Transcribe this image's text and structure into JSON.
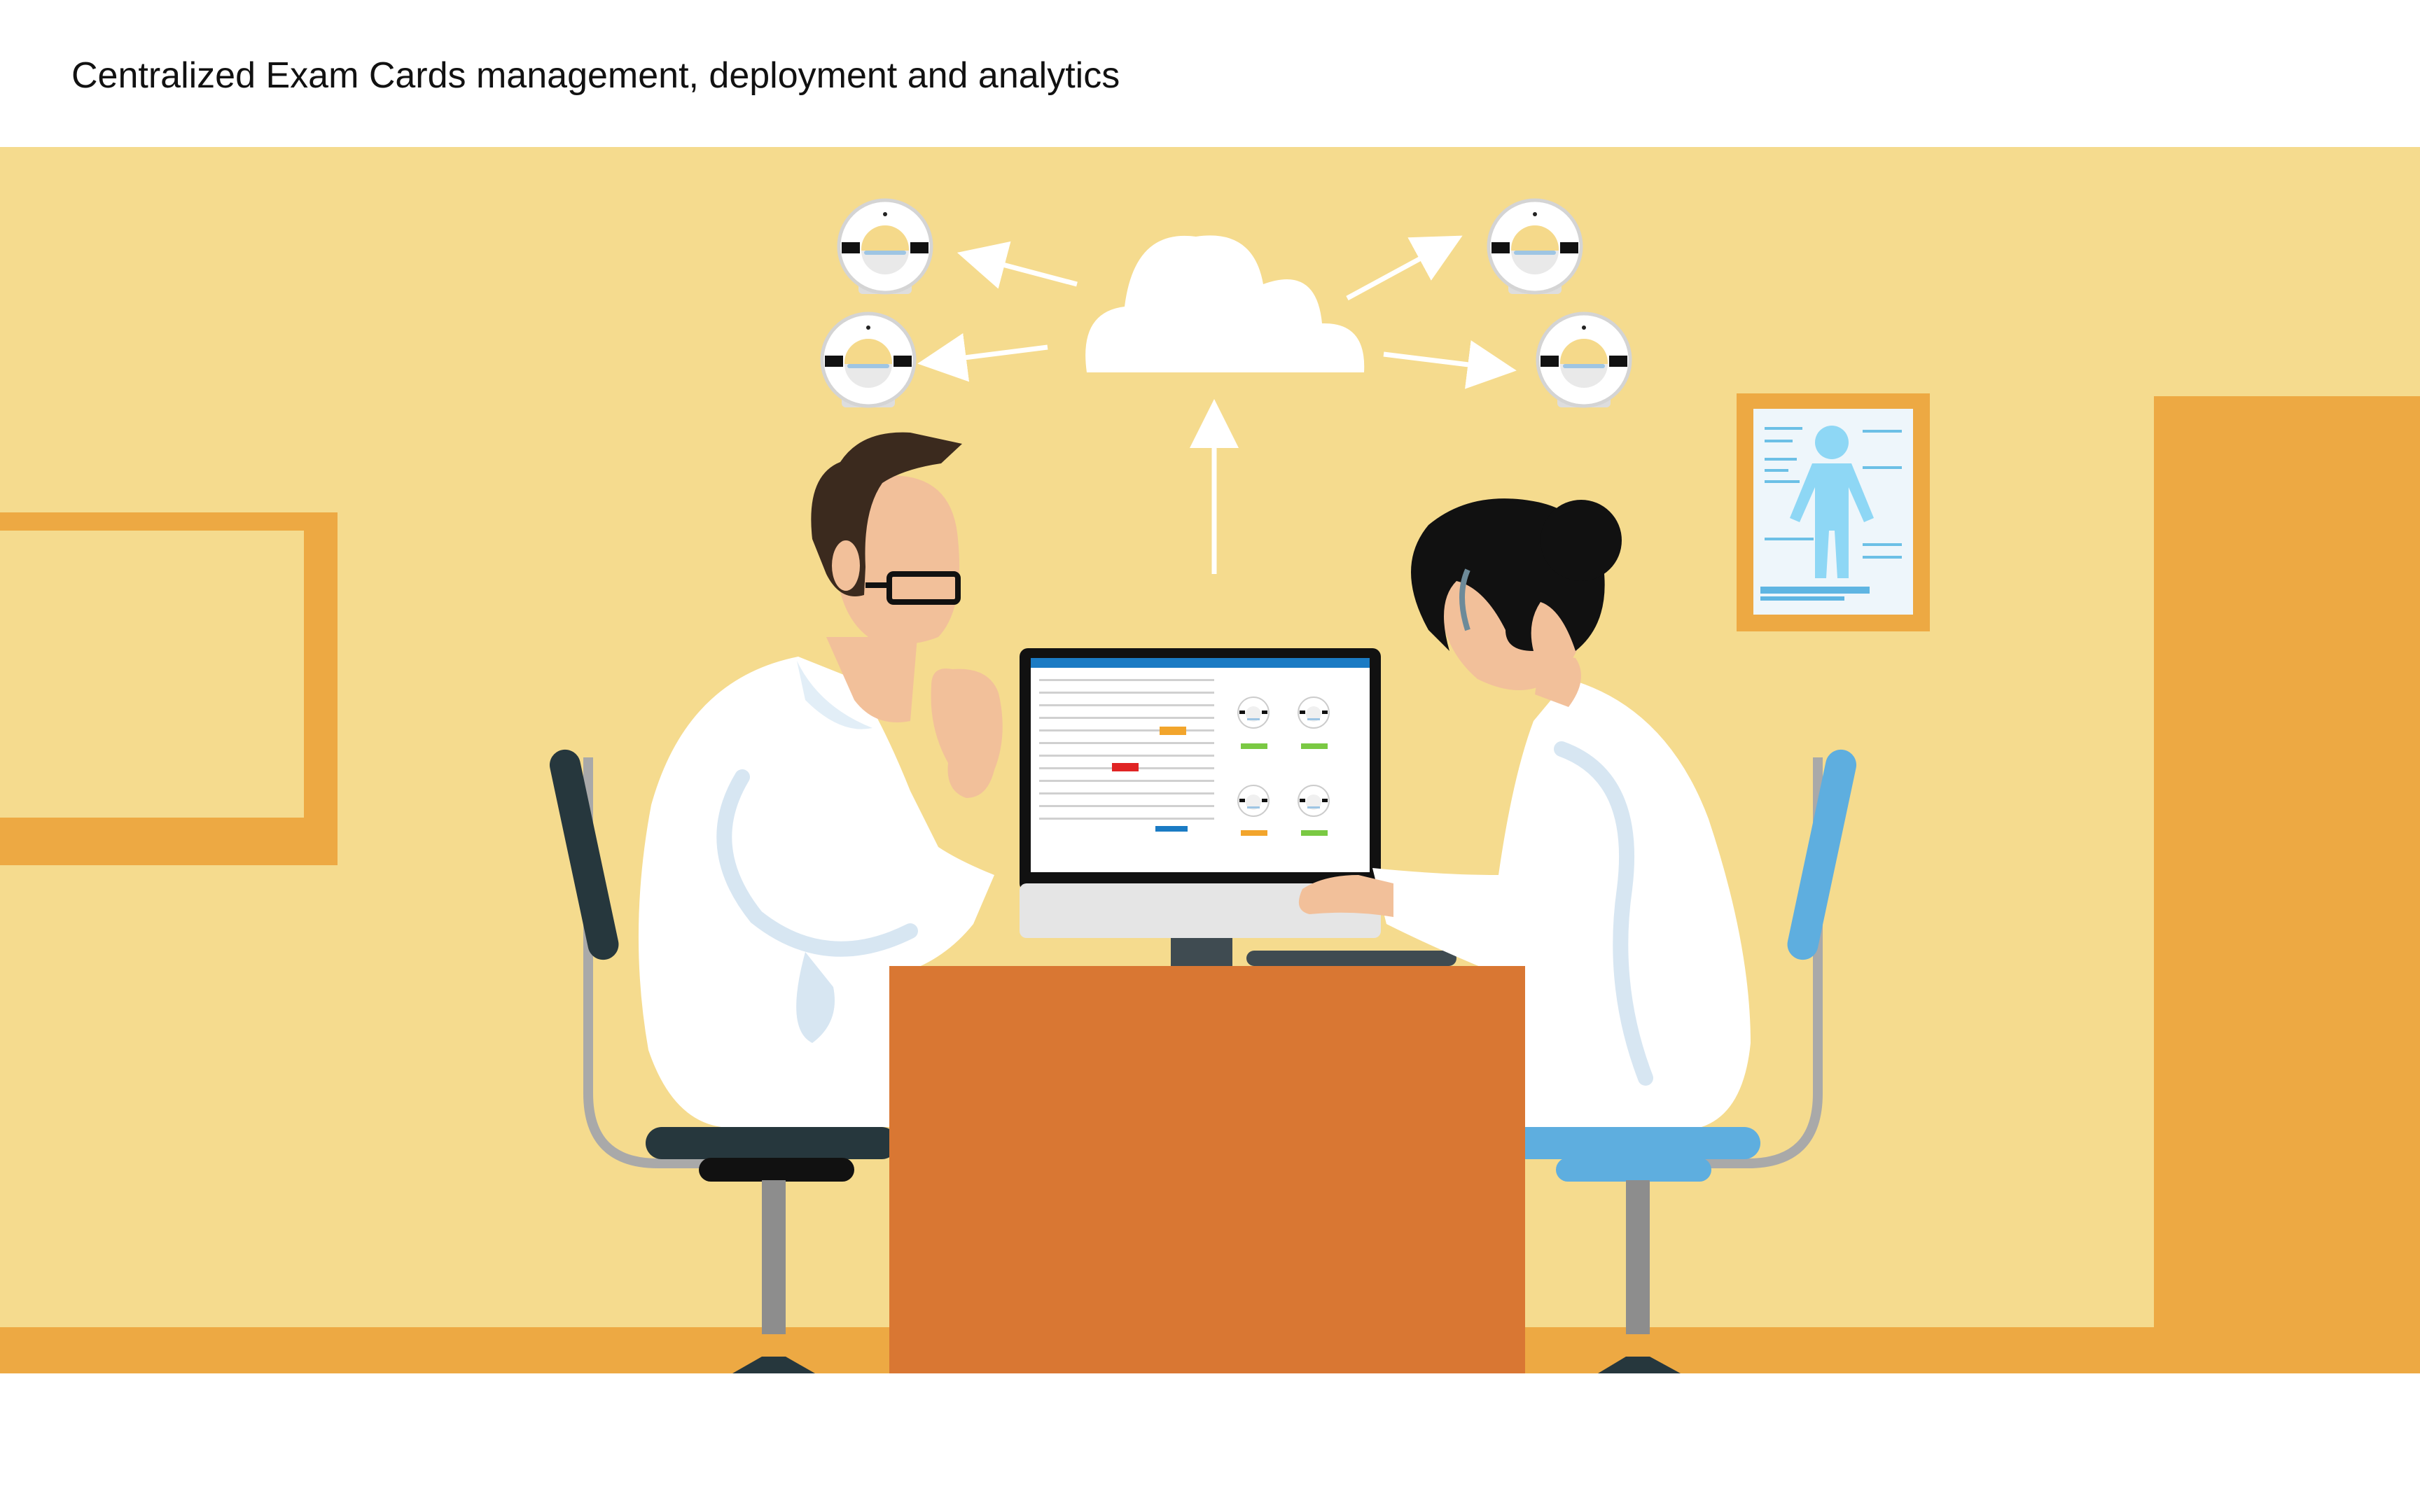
{
  "slide": {
    "title": "Centralized Exam Cards management, deployment and analytics"
  },
  "illustration": {
    "colors": {
      "wall": "#F5DB8E",
      "accent_orange": "#EDA943",
      "desk": "#D97733",
      "coat": "#FFFFFF",
      "skin": "#F2C09A",
      "screen_header": "#1B7BC4",
      "status_green": "#7AC943",
      "status_orange": "#F2A52C",
      "status_red": "#E02424",
      "chair_dark": "#26373D",
      "chair_blue": "#5EAEDF"
    },
    "icons": [
      "cloud-icon",
      "mri-scanner-icon",
      "arrow-icon",
      "anatomy-poster-icon"
    ]
  }
}
